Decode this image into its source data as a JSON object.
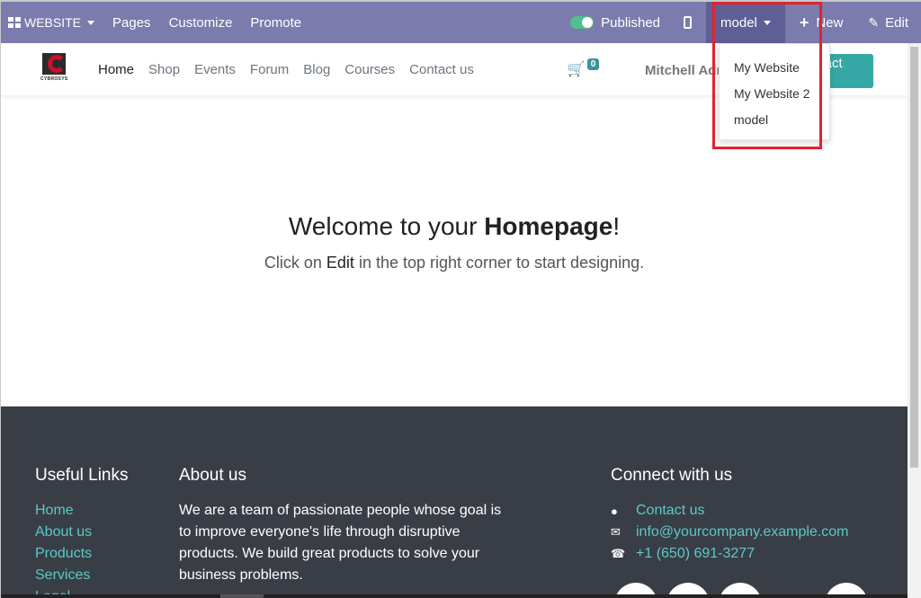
{
  "adminbar": {
    "website_label": "WEBSITE",
    "pages": "Pages",
    "customize": "Customize",
    "promote": "Promote",
    "published": "Published",
    "model": "model",
    "new": "New",
    "edit": "Edit"
  },
  "dropdown": {
    "items": [
      "My Website",
      "My Website 2",
      "model"
    ]
  },
  "logo": {
    "text": "CYBROSYS"
  },
  "nav": {
    "links": [
      "Home",
      "Shop",
      "Events",
      "Forum",
      "Blog",
      "Courses",
      "Contact us"
    ],
    "cart_count": "0",
    "user": "Mitchell Admin",
    "contact_button": "Contact Us"
  },
  "hero": {
    "title_prefix": "Welcome to your ",
    "title_bold": "Homepage",
    "title_suffix": "!",
    "sub_prefix": "Click on ",
    "sub_bold": "Edit",
    "sub_suffix": " in the top right corner to start designing."
  },
  "footer": {
    "useful_links_title": "Useful Links",
    "useful_links": [
      "Home",
      "About us",
      "Products",
      "Services",
      "Legal"
    ],
    "about_title": "About us",
    "about_text": "We are a team of passionate people whose goal is to improve everyone's life through disruptive products. We build great products to solve your business problems.",
    "connect_title": "Connect with us",
    "contact_us": "Contact us",
    "email": "info@yourcompany.example.com",
    "phone": "+1 (650) 691-3277"
  },
  "colors": {
    "adminbar": "#7c7bad",
    "accent": "#35a8a5",
    "footer_bg": "#393e46",
    "highlight": "#e0242c"
  }
}
